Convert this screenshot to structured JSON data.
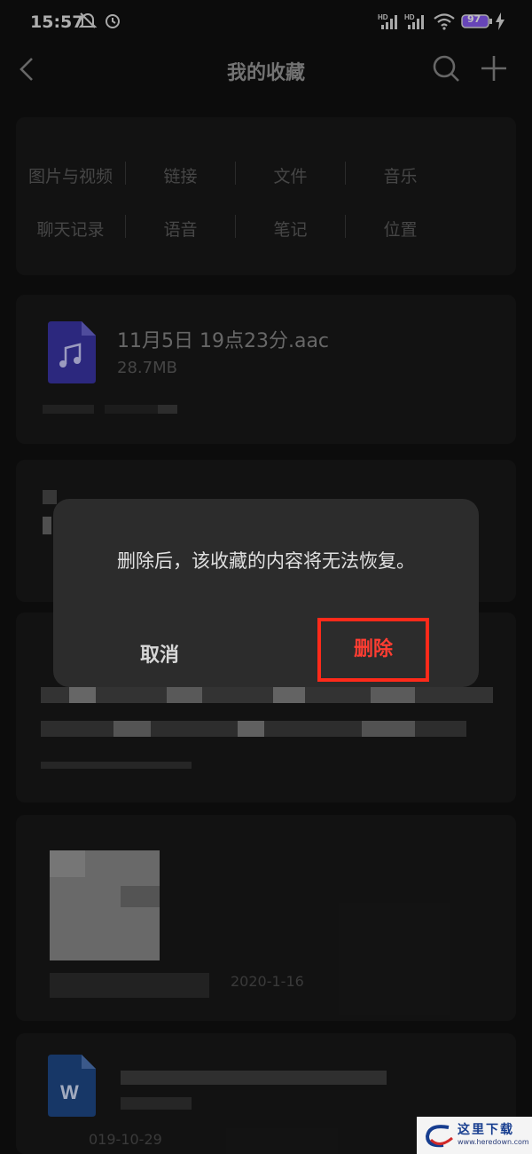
{
  "status_bar": {
    "time": "15:57",
    "battery": "97"
  },
  "header": {
    "title": "我的收藏"
  },
  "filters": {
    "row1": [
      "图片与视频",
      "链接",
      "文件",
      "音乐"
    ],
    "row2": [
      "聊天记录",
      "语音",
      "笔记",
      "位置"
    ]
  },
  "items": [
    {
      "name": "11月5日 19点23分.aac",
      "size": "28.7MB",
      "icon": "music-file-icon"
    },
    {
      "date": "2020-1-16"
    },
    {
      "date": "019-10-29",
      "icon": "word-file-icon"
    }
  ],
  "dialog": {
    "message": "删除后，该收藏的内容将无法恢复。",
    "cancel": "取消",
    "delete": "删除"
  },
  "watermark": {
    "text": "这里下载",
    "url": "www.heredown.com"
  },
  "colors": {
    "background": "#101010",
    "card": "#191919",
    "dialog": "#2c2c2c",
    "delete_red": "#ff3d32",
    "highlight_box": "#ff2a1a"
  }
}
